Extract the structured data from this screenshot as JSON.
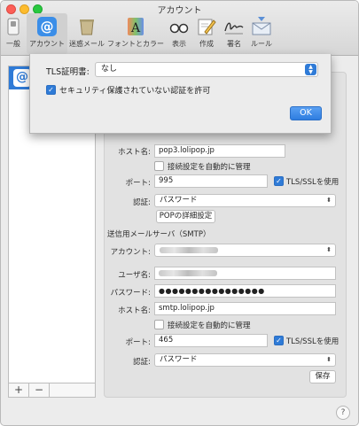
{
  "window": {
    "title": "アカウント"
  },
  "toolbar": {
    "items": [
      {
        "label": "一般",
        "icon": "switch-icon"
      },
      {
        "label": "アカウント",
        "icon": "at-sign-icon"
      },
      {
        "label": "迷惑メール",
        "icon": "trash-can-icon"
      },
      {
        "label": "フォントとカラー",
        "icon": "font-color-icon"
      },
      {
        "label": "表示",
        "icon": "glasses-icon"
      },
      {
        "label": "作成",
        "icon": "pencil-note-icon"
      },
      {
        "label": "署名",
        "icon": "signature-icon"
      },
      {
        "label": "ルール",
        "icon": "rule-envelope-icon"
      }
    ],
    "active_index": 1
  },
  "account_list": {
    "add_label": "+",
    "remove_label": "−"
  },
  "incoming": {
    "host_label": "ホスト名:",
    "host_value": "pop3.lolipop.jp",
    "auto_manage_label": "接続設定を自動的に管理",
    "auto_manage_checked": false,
    "port_label": "ポート:",
    "port_value": "995",
    "tls_label": "TLS/SSLを使用",
    "tls_checked": true,
    "auth_label": "認証:",
    "auth_value": "パスワード",
    "pop_details_button": "POPの詳細設定"
  },
  "outgoing": {
    "section_title": "送信用メールサーバ（SMTP）",
    "account_label": "アカウント:",
    "username_label": "ユーザ名:",
    "password_label": "パスワード:",
    "password_value": "●●●●●●●●●●●●●●●●",
    "host_label": "ホスト名:",
    "host_value": "smtp.lolipop.jp",
    "auto_manage_label": "接続設定を自動的に管理",
    "auto_manage_checked": false,
    "port_label": "ポート:",
    "port_value": "465",
    "tls_label": "TLS/SSLを使用",
    "tls_checked": true,
    "auth_label": "認証:",
    "auth_value": "パスワード",
    "save_button": "保存"
  },
  "sheet": {
    "tls_cert_label": "TLS証明書:",
    "tls_cert_value": "なし",
    "allow_insecure_label": "セキュリティ保護されていない認証を許可",
    "allow_insecure_checked": true,
    "ok_button": "OK"
  },
  "help": {
    "label": "?"
  },
  "colors": {
    "accent": "#2f7bd7",
    "ok_button": "#2e7de0"
  }
}
